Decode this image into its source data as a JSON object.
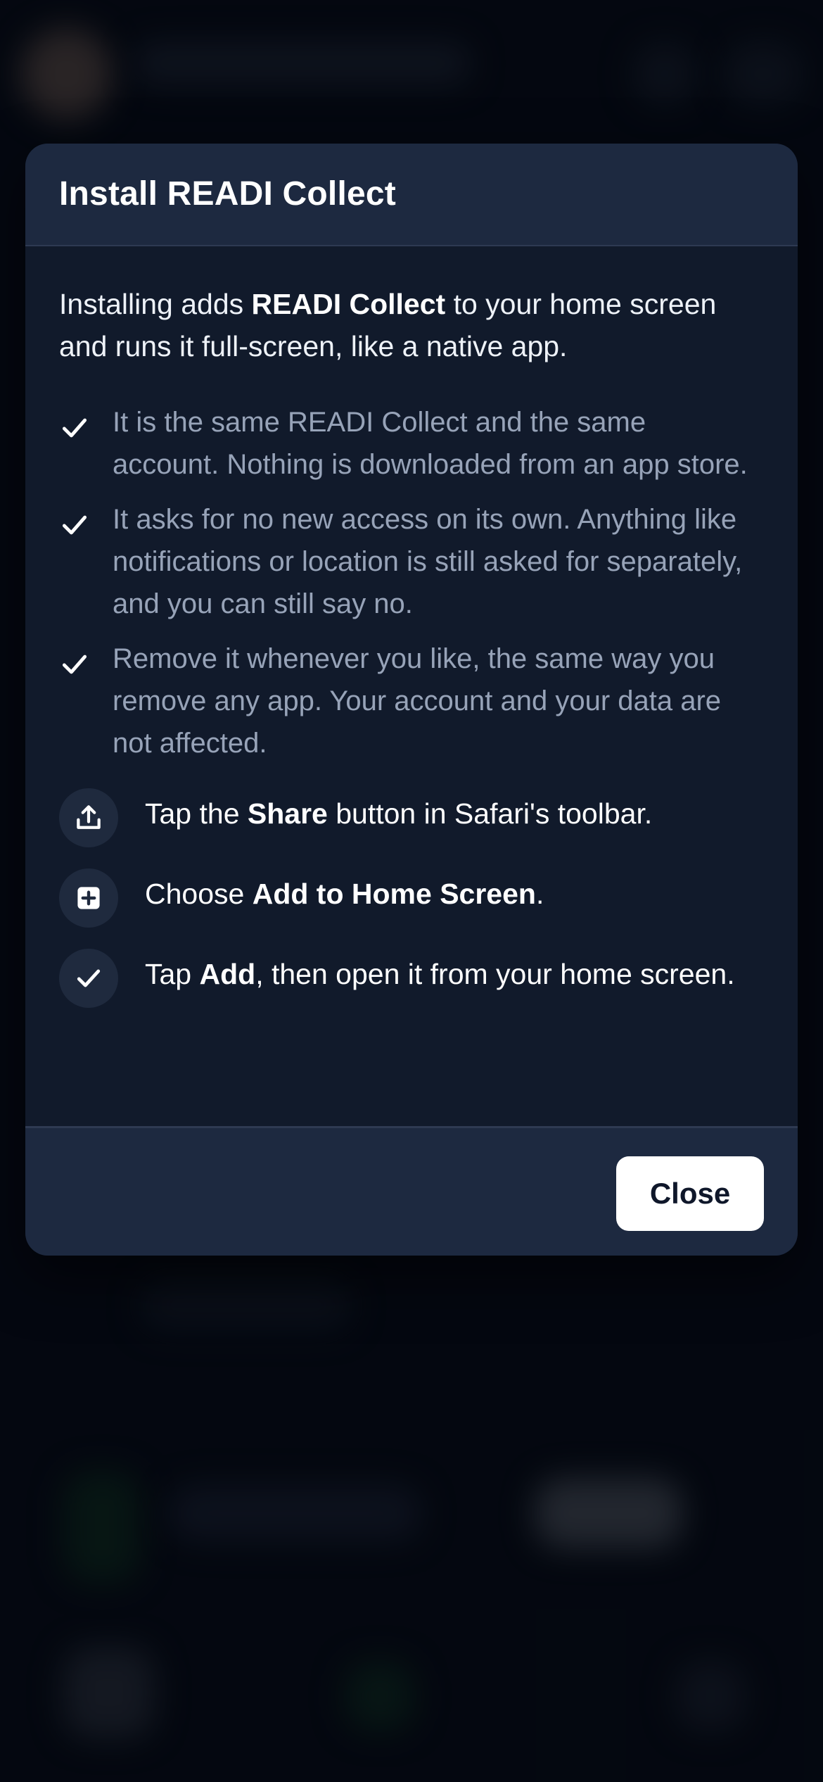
{
  "modal": {
    "title": "Install READI Collect",
    "intro": {
      "before": "Installing adds ",
      "app_name": "READI Collect",
      "after": " to your home screen and runs it full-screen, like a native app."
    },
    "checks": [
      "It is the same READI Collect and the same account. Nothing is downloaded from an app store.",
      "It asks for no new access on its own. Anything like notifications or location is still asked for separately, and you can still say no.",
      "Remove it whenever you like, the same way you remove any app. Your account and your data are not affected."
    ],
    "steps": [
      {
        "icon": "share-icon",
        "before": "Tap the ",
        "bold": "Share",
        "after": " button in Safari's toolbar."
      },
      {
        "icon": "add-square-icon",
        "before": "Choose ",
        "bold": "Add to Home Screen",
        "after": "."
      },
      {
        "icon": "checkmark-icon",
        "before": "Tap ",
        "bold": "Add",
        "after": ", then open it from your home screen."
      }
    ],
    "close_label": "Close"
  },
  "colors": {
    "modal_background": "#111a2b",
    "header_footer_background": "#1d2940",
    "muted_text": "#97a3b8",
    "button_background": "#ffffff"
  }
}
